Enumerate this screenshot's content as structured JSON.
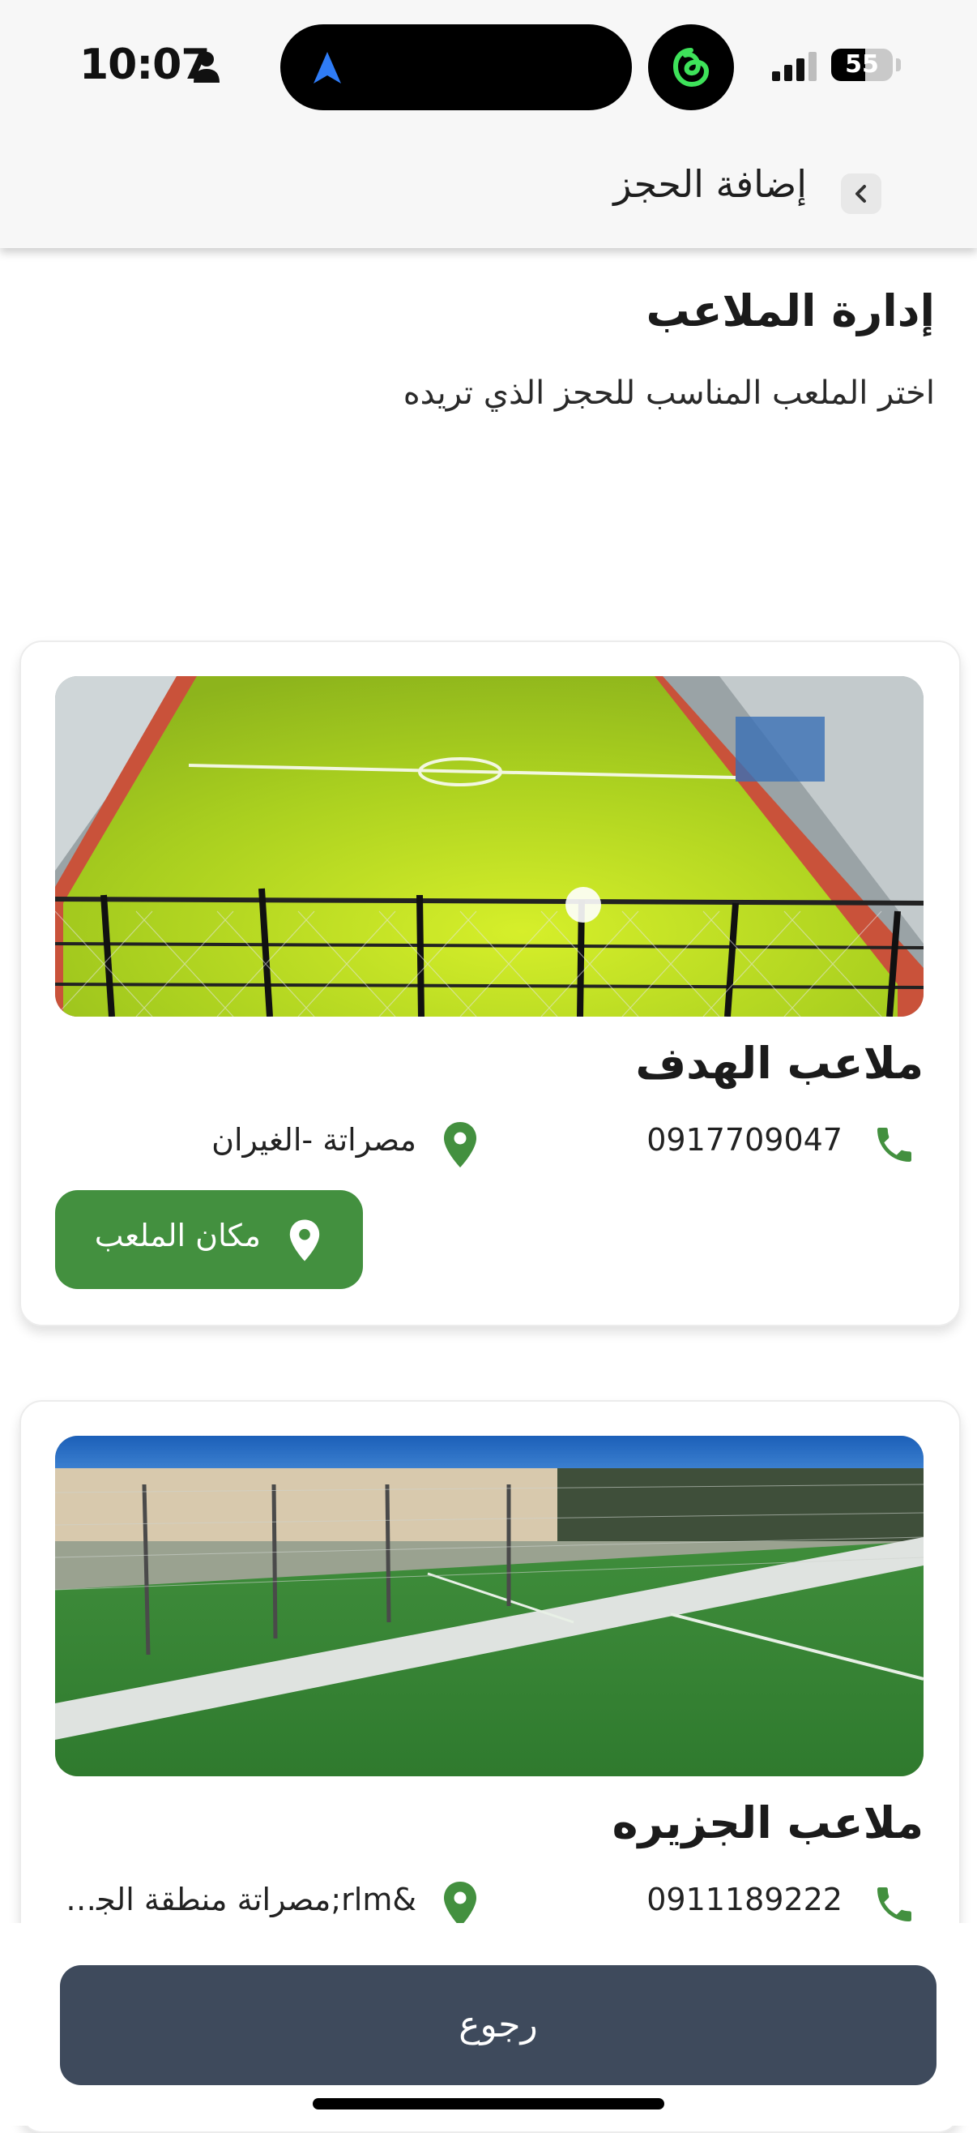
{
  "status_bar": {
    "time": "10:07",
    "battery_level": "55",
    "battery_fraction": 0.55
  },
  "header": {
    "title": "إضافة الحجز"
  },
  "page": {
    "title": "إدارة الملاعب",
    "subtitle": "اختر الملعب المناسب للحجز الذي تريده"
  },
  "fields": [
    {
      "name": "ملاعب الهدف",
      "phone": "0917709047",
      "location": "مصراتة -الغيران",
      "location_button": "مكان الملعب"
    },
    {
      "name": "ملاعب الجزيره",
      "phone": "0911189222",
      "location": "‏&rlm;مصراتة منطقة الجز..."
    }
  ],
  "footer": {
    "back_label": "رجوع"
  },
  "colors": {
    "accent_green": "#43903f",
    "back_button": "#3e4a5c"
  },
  "icons": [
    "person-icon",
    "navigation-arrow-icon",
    "threads-icon",
    "signal-icon",
    "battery-icon",
    "chevron-left-icon",
    "phone-icon",
    "location-pin-icon"
  ]
}
